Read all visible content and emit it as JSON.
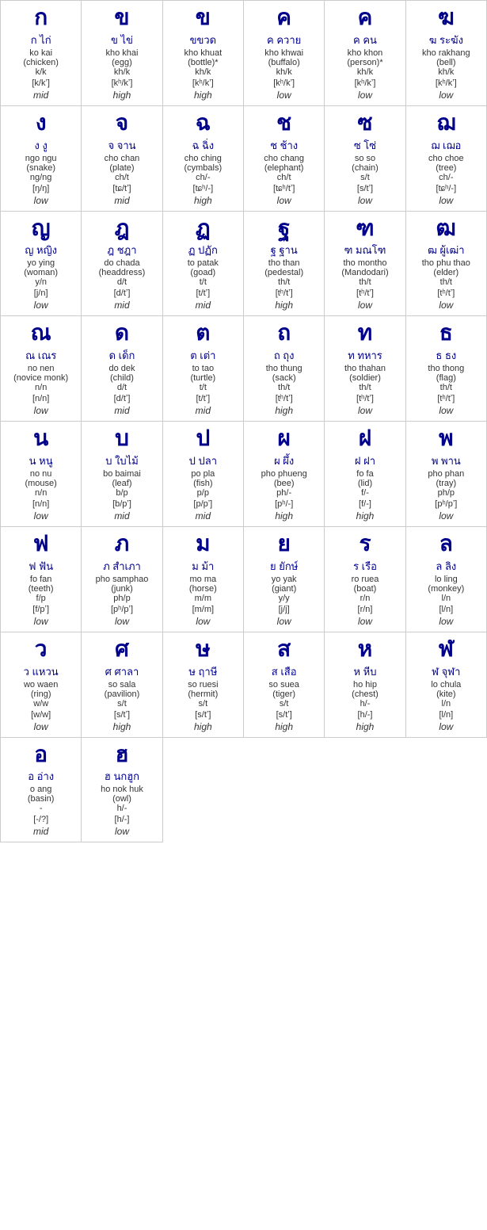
{
  "cells": [
    {
      "thai_large": "ก",
      "thai_name": "ก ไก่",
      "roman_name": "ko kai",
      "meaning": "(chicken)",
      "sound": "k/k",
      "ipa": "[k/kʼ]",
      "tone": "mid"
    },
    {
      "thai_large": "ข",
      "thai_name": "ข ไข่",
      "roman_name": "kho khai",
      "meaning": "(egg)",
      "sound": "kh/k",
      "ipa": "[kʰ/kʼ]",
      "tone": "high"
    },
    {
      "thai_large": "ข",
      "thai_name": "ขขวด",
      "roman_name": "kho khuat",
      "meaning": "(bottle)*",
      "sound": "kh/k",
      "ipa": "[kʰ/kʼ]",
      "tone": "high"
    },
    {
      "thai_large": "ค",
      "thai_name": "ค ควาย",
      "roman_name": "kho khwai",
      "meaning": "(buffalo)",
      "sound": "kh/k",
      "ipa": "[kʰ/kʼ]",
      "tone": "low"
    },
    {
      "thai_large": "ค",
      "thai_name": "ค คน",
      "roman_name": "kho khon",
      "meaning": "(person)*",
      "sound": "kh/k",
      "ipa": "[kʰ/kʼ]",
      "tone": "low"
    },
    {
      "thai_large": "ฆ",
      "thai_name": "ฆ ระฆัง",
      "roman_name": "kho rakhang",
      "meaning": "(bell)",
      "sound": "kh/k",
      "ipa": "[kʰ/kʼ]",
      "tone": "low"
    },
    {
      "thai_large": "ง",
      "thai_name": "ง งู",
      "roman_name": "ngo ngu",
      "meaning": "(snake)",
      "sound": "ng/ng",
      "ipa": "[ŋ/ŋ]",
      "tone": "low"
    },
    {
      "thai_large": "จ",
      "thai_name": "จ จาน",
      "roman_name": "cho chan",
      "meaning": "(plate)",
      "sound": "ch/t",
      "ipa": "[tɕ/tʼ]",
      "tone": "mid"
    },
    {
      "thai_large": "ฉ",
      "thai_name": "ฉ ฉิ่ง",
      "roman_name": "cho ching",
      "meaning": "(cymbals)",
      "sound": "ch/-",
      "ipa": "[tɕʰ/-]",
      "tone": "high"
    },
    {
      "thai_large": "ช",
      "thai_name": "ช ช้าง",
      "roman_name": "cho chang",
      "meaning": "(elephant)",
      "sound": "ch/t",
      "ipa": "[tɕʰ/tʼ]",
      "tone": "low"
    },
    {
      "thai_large": "ซ",
      "thai_name": "ซ โซ่",
      "roman_name": "so so",
      "meaning": "(chain)",
      "sound": "s/t",
      "ipa": "[s/tʼ]",
      "tone": "low"
    },
    {
      "thai_large": "ฌ",
      "thai_name": "ฌ เฌอ",
      "roman_name": "cho choe",
      "meaning": "(tree)",
      "sound": "ch/-",
      "ipa": "[tɕʰ/-]",
      "tone": "low"
    },
    {
      "thai_large": "ญ",
      "thai_name": "ญ หญิง",
      "roman_name": "yo ying",
      "meaning": "(woman)",
      "sound": "y/n",
      "ipa": "[j/n]",
      "tone": "low"
    },
    {
      "thai_large": "ฎ",
      "thai_name": "ฎ ชฎา",
      "roman_name": "do chada",
      "meaning": "(headdress)",
      "sound": "d/t",
      "ipa": "[d/tʼ]",
      "tone": "mid"
    },
    {
      "thai_large": "ฏ",
      "thai_name": "ฏ ปฏัก",
      "roman_name": "to patak",
      "meaning": "(goad)",
      "sound": "t/t",
      "ipa": "[t/tʼ]",
      "tone": "mid"
    },
    {
      "thai_large": "ฐ",
      "thai_name": "ฐ ฐาน",
      "roman_name": "tho than",
      "meaning": "(pedestal)",
      "sound": "th/t",
      "ipa": "[tʰ/tʼ]",
      "tone": "high"
    },
    {
      "thai_large": "ฑ",
      "thai_name": "ฑ มณโฑ",
      "roman_name": "tho montho",
      "meaning": "(Mandodari)",
      "sound": "th/t",
      "ipa": "[tʰ/tʼ]",
      "tone": "low"
    },
    {
      "thai_large": "ฒ",
      "thai_name": "ฒ ผู้เฒ่า",
      "roman_name": "tho phu thao",
      "meaning": "(elder)",
      "sound": "th/t",
      "ipa": "[tʰ/tʼ]",
      "tone": "low"
    },
    {
      "thai_large": "ณ",
      "thai_name": "ณ เณร",
      "roman_name": "no nen",
      "meaning": "(novice monk)",
      "sound": "n/n",
      "ipa": "[n/n]",
      "tone": "low"
    },
    {
      "thai_large": "ด",
      "thai_name": "ด เด็ก",
      "roman_name": "do dek",
      "meaning": "(child)",
      "sound": "d/t",
      "ipa": "[d/tʼ]",
      "tone": "mid"
    },
    {
      "thai_large": "ต",
      "thai_name": "ต เต่า",
      "roman_name": "to tao",
      "meaning": "(turtle)",
      "sound": "t/t",
      "ipa": "[t/tʼ]",
      "tone": "mid"
    },
    {
      "thai_large": "ถ",
      "thai_name": "ถ ถุง",
      "roman_name": "tho thung",
      "meaning": "(sack)",
      "sound": "th/t",
      "ipa": "[tʰ/tʼ]",
      "tone": "high"
    },
    {
      "thai_large": "ท",
      "thai_name": "ท ทหาร",
      "roman_name": "tho thahan",
      "meaning": "(soldier)",
      "sound": "th/t",
      "ipa": "[tʰ/tʼ]",
      "tone": "low"
    },
    {
      "thai_large": "ธ",
      "thai_name": "ธ ธง",
      "roman_name": "tho thong",
      "meaning": "(flag)",
      "sound": "th/t",
      "ipa": "[tʰ/tʼ]",
      "tone": "low"
    },
    {
      "thai_large": "น",
      "thai_name": "น หนู",
      "roman_name": "no nu",
      "meaning": "(mouse)",
      "sound": "n/n",
      "ipa": "[n/n]",
      "tone": "low"
    },
    {
      "thai_large": "บ",
      "thai_name": "บ ใบไม้",
      "roman_name": "bo baimai",
      "meaning": "(leaf)",
      "sound": "b/p",
      "ipa": "[b/pʼ]",
      "tone": "mid"
    },
    {
      "thai_large": "ป",
      "thai_name": "ป ปลา",
      "roman_name": "po pla",
      "meaning": "(fish)",
      "sound": "p/p",
      "ipa": "[p/pʼ]",
      "tone": "mid"
    },
    {
      "thai_large": "ผ",
      "thai_name": "ผ ผึ้ง",
      "roman_name": "pho phueng",
      "meaning": "(bee)",
      "sound": "ph/-",
      "ipa": "[pʰ/-]",
      "tone": "high"
    },
    {
      "thai_large": "ฝ",
      "thai_name": "ฝ ฝา",
      "roman_name": "fo fa",
      "meaning": "(lid)",
      "sound": "f/-",
      "ipa": "[f/-]",
      "tone": "high"
    },
    {
      "thai_large": "พ",
      "thai_name": "พ พาน",
      "roman_name": "pho phan",
      "meaning": "(tray)",
      "sound": "ph/p",
      "ipa": "[pʰ/pʼ]",
      "tone": "low"
    },
    {
      "thai_large": "ฟ",
      "thai_name": "ฟ ฟัน",
      "roman_name": "fo fan",
      "meaning": "(teeth)",
      "sound": "f/p",
      "ipa": "[f/pʼ]",
      "tone": "low"
    },
    {
      "thai_large": "ภ",
      "thai_name": "ภ สำเภา",
      "roman_name": "pho samphao",
      "meaning": "(junk)",
      "sound": "ph/p",
      "ipa": "[pʰ/pʼ]",
      "tone": "low"
    },
    {
      "thai_large": "ม",
      "thai_name": "ม ม้า",
      "roman_name": "mo ma",
      "meaning": "(horse)",
      "sound": "m/m",
      "ipa": "[m/m]",
      "tone": "low"
    },
    {
      "thai_large": "ย",
      "thai_name": "ย ยักษ์",
      "roman_name": "yo yak",
      "meaning": "(giant)",
      "sound": "y/y",
      "ipa": "[j/j]",
      "tone": "low"
    },
    {
      "thai_large": "ร",
      "thai_name": "ร เรือ",
      "roman_name": "ro ruea",
      "meaning": "(boat)",
      "sound": "r/n",
      "ipa": "[r/n]",
      "tone": "low"
    },
    {
      "thai_large": "ล",
      "thai_name": "ล ลิง",
      "roman_name": "lo ling",
      "meaning": "(monkey)",
      "sound": "l/n",
      "ipa": "[l/n]",
      "tone": "low"
    },
    {
      "thai_large": "ว",
      "thai_name": "ว แหวน",
      "roman_name": "wo waen",
      "meaning": "(ring)",
      "sound": "w/w",
      "ipa": "[w/w]",
      "tone": "low"
    },
    {
      "thai_large": "ศ",
      "thai_name": "ศ ศาลา",
      "roman_name": "so sala",
      "meaning": "(pavilion)",
      "sound": "s/t",
      "ipa": "[s/tʼ]",
      "tone": "high"
    },
    {
      "thai_large": "ษ",
      "thai_name": "ษ ฤาษี",
      "roman_name": "so ruesi",
      "meaning": "(hermit)",
      "sound": "s/t",
      "ipa": "[s/tʼ]",
      "tone": "high"
    },
    {
      "thai_large": "ส",
      "thai_name": "ส เสือ",
      "roman_name": "so suea",
      "meaning": "(tiger)",
      "sound": "s/t",
      "ipa": "[s/tʼ]",
      "tone": "high"
    },
    {
      "thai_large": "ห",
      "thai_name": "ห หีบ",
      "roman_name": "ho hip",
      "meaning": "(chest)",
      "sound": "h/-",
      "ipa": "[h/-]",
      "tone": "high"
    },
    {
      "thai_large": "ฬ",
      "thai_name": "ฬ จุฬา",
      "roman_name": "lo chula",
      "meaning": "(kite)",
      "sound": "l/n",
      "ipa": "[l/n]",
      "tone": "low"
    },
    {
      "thai_large": "อ",
      "thai_name": "อ อ่าง",
      "roman_name": "o ang",
      "meaning": "(basin)",
      "sound": "-",
      "ipa": "[-/?]",
      "tone": "mid"
    },
    {
      "thai_large": "ฮ",
      "thai_name": "ฮ นกฮูก",
      "roman_name": "ho nok huk",
      "meaning": "(owl)",
      "sound": "h/-",
      "ipa": "[h/-]",
      "tone": "low"
    }
  ]
}
